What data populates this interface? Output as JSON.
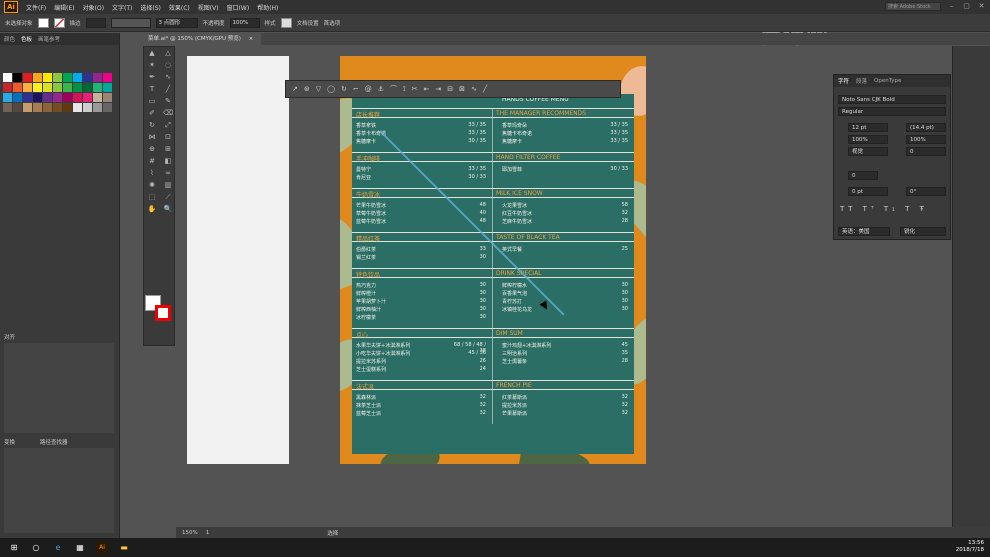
{
  "menubar": {
    "logo": "Ai",
    "items": [
      "文件(F)",
      "编辑(E)",
      "对象(O)",
      "文字(T)",
      "选择(S)",
      "效果(C)",
      "视图(V)",
      "窗口(W)",
      "帮助(H)"
    ],
    "search_placeholder": "搜索 Adobe Stock"
  },
  "control": {
    "no_selection": "未选择对象",
    "stroke_label": "描边",
    "brush": "3 点圆形",
    "opacity_label": "不透明度",
    "opacity_value": "100%",
    "style_label": "样式",
    "doc_setup": "文档设置",
    "prefs": "首选项"
  },
  "document": {
    "tab_title": "菜单.ai* @ 150% (CMYK/GPU 预览)",
    "close": "×"
  },
  "left_panel": {
    "tabs": [
      "颜色",
      "色板",
      "画笔参考"
    ],
    "swatches": [
      "#ffffff",
      "#000000",
      "#e31b23",
      "#f5a623",
      "#ffe600",
      "#8dc63f",
      "#00a651",
      "#00aeef",
      "#2e3192",
      "#92278f",
      "#ec008c",
      "#c1272d",
      "#f15a24",
      "#fbb03b",
      "#fcee21",
      "#d9e021",
      "#8cc63f",
      "#39b54a",
      "#009245",
      "#006837",
      "#22b573",
      "#00a99d",
      "#29abe2",
      "#0071bc",
      "#2e3192",
      "#1b1464",
      "#662d91",
      "#93278f",
      "#9e005d",
      "#d4145a",
      "#ed1e79",
      "#c7b299",
      "#998675",
      "#736357",
      "#534741",
      "#c69c6d",
      "#a67c52",
      "#8c6239",
      "#754c24",
      "#603813",
      "#e6e6e6",
      "#cccccc",
      "#999999",
      "#666666"
    ],
    "section_align": "对齐",
    "section_transform": "变换",
    "section_pathfinder": "路径查找器"
  },
  "menu_art": {
    "header_en": "HANDS COFFEE MENU",
    "sections": [
      {
        "cn": "店长推荐",
        "en": "THE MANAGER RECOMMENDS",
        "left": [
          [
            "香草拿铁",
            "33 / 35"
          ],
          [
            "香草卡布奇诺",
            "33 / 35"
          ],
          [
            "焦糖摩卡",
            "30 / 35"
          ]
        ],
        "right": [
          [
            "香草玛奇朵",
            "33 / 35"
          ],
          [
            "焦糖卡布奇诺",
            "33 / 35"
          ],
          [
            "焦糖摩卡",
            "33 / 35"
          ]
        ]
      },
      {
        "cn": "手冲咖啡",
        "en": "HAND FILTER COFFEE",
        "left": [
          [
            "曼特宁",
            "33 / 35"
          ],
          [
            "肯尼亚",
            "30 / 33"
          ]
        ],
        "right": [
          [
            "耶加雪菲",
            "30 / 33"
          ]
        ]
      },
      {
        "cn": "牛奶雪冰",
        "en": "MILK ICE SNOW",
        "left": [
          [
            "芒果牛奶雪冰",
            "48"
          ],
          [
            "草莓牛奶雪冰",
            "40"
          ],
          [
            "蓝莓牛奶雪冰",
            "48"
          ]
        ],
        "right": [
          [
            "火龙果雪冰",
            "58"
          ],
          [
            "红豆牛奶雪冰",
            "32"
          ],
          [
            "芝麻牛奶雪冰",
            "28"
          ]
        ]
      },
      {
        "cn": "精品红茶",
        "en": "TASTE OF BLACK TEA",
        "left": [
          [
            "伯爵红茶",
            "33"
          ],
          [
            "锡兰红茶",
            "30"
          ]
        ],
        "right": [
          [
            "英式早餐",
            "25"
          ]
        ]
      },
      {
        "cn": "特色饮品",
        "en": "DRINK SPECIAL",
        "left": [
          [
            "热巧克力",
            "30"
          ],
          [
            "鲜榨橙汁",
            "30"
          ],
          [
            "苹果胡萝卜汁",
            "30"
          ],
          [
            "鲜榨西柚汁",
            "30"
          ],
          [
            "冰柠檬茶",
            "30"
          ]
        ],
        "right": [
          [
            "鲜榨柠檬水",
            "30"
          ],
          [
            "百香果气泡",
            "30"
          ],
          [
            "青柠苏打",
            "30"
          ],
          [
            "冰镇桂花乌龙",
            "30"
          ]
        ]
      },
      {
        "cn": "点心",
        "en": "DIM SUM",
        "left": [
          [
            "水果华夫饼+冰淇淋系列",
            "68 / 58 / 48 / 38"
          ],
          [
            "小吃华夫饼+冰淇淋系列",
            "45 / 36"
          ],
          [
            "提拉米苏系列",
            "26"
          ],
          [
            "芝士蛋糕系列",
            "24"
          ]
        ],
        "right": [
          [
            "蜜汁鸡翅+冰淇淋系列",
            "45"
          ],
          [
            "三明治系列",
            "35"
          ],
          [
            "芝士焗薯条",
            "28"
          ]
        ]
      },
      {
        "cn": "法式派",
        "en": "FRENCH PIE",
        "left": [
          [
            "黑森林派",
            "32"
          ],
          [
            "抹茶芝士派",
            "32"
          ],
          [
            "蓝莓芝士派",
            "32"
          ]
        ],
        "right": [
          [
            "红茶慕斯派",
            "32"
          ],
          [
            "提拉米苏派",
            "32"
          ],
          [
            "芒果慕斯派",
            "32"
          ]
        ]
      }
    ]
  },
  "char_panel": {
    "tabs": [
      "字符",
      "段落",
      "OpenType"
    ],
    "font": "Noto Sans CJK Bold",
    "style": "Regular",
    "size": "12 pt",
    "leading": "(14.4 pt)",
    "h_scale": "100%",
    "v_scale": "100%",
    "kerning": "视觉",
    "tracking": "0",
    "baseline": "0 pt",
    "rotation": "0°",
    "lang": "英语：美国",
    "aa": "锐化"
  },
  "status": {
    "zoom": "150%",
    "artboard": "1",
    "tool": "选择"
  },
  "taskbar": {
    "time": "13:56",
    "date": "2018/7/18"
  },
  "watermark": "虎课网"
}
